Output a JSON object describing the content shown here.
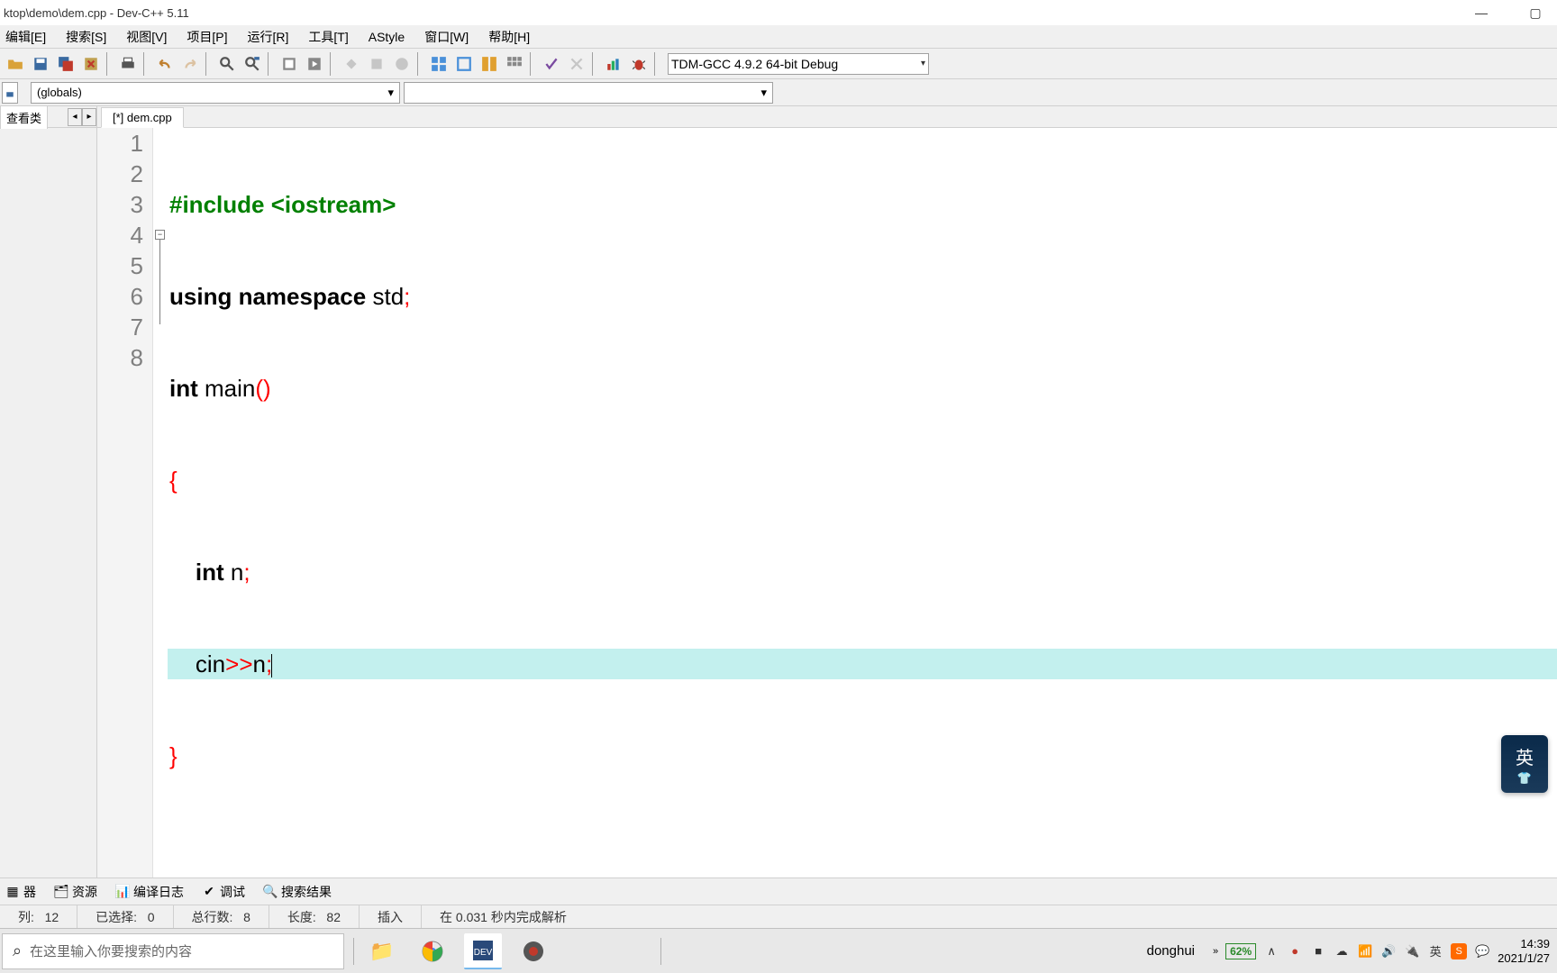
{
  "title": "ktop\\demo\\dem.cpp - Dev-C++ 5.11",
  "menu": [
    "编辑[E]",
    "搜索[S]",
    "视图[V]",
    "项目[P]",
    "运行[R]",
    "工具[T]",
    "AStyle",
    "窗口[W]",
    "帮助[H]"
  ],
  "compiler": "TDM-GCC 4.9.2 64-bit Debug",
  "scope_global": "(globals)",
  "side_tab": "查看类",
  "editor_tab": "[*] dem.cpp",
  "code": {
    "lines": [
      "1",
      "2",
      "3",
      "4",
      "5",
      "6",
      "7",
      "8"
    ],
    "l1_pp": "#include <iostream>",
    "l2_kw1": "using",
    "l2_kw2": "namespace",
    "l2_id": "std",
    "l3_kw": "int",
    "l3_id": "main",
    "l5_kw": "int",
    "l5_id": "n",
    "l6_id1": "cin",
    "l6_id2": "n"
  },
  "bottom_tabs": [
    "器",
    "资源",
    "编译日志",
    "调试",
    "搜索结果"
  ],
  "status": {
    "col_lbl": "列:",
    "col_val": "12",
    "sel_lbl": "已选择:",
    "sel_val": "0",
    "lines_lbl": "总行数:",
    "lines_val": "8",
    "len_lbl": "长度:",
    "len_val": "82",
    "ins": "插入",
    "parse": "在 0.031 秒内完成解析"
  },
  "ime": {
    "lang": "英"
  },
  "taskbar": {
    "search_placeholder": "在这里输入你要搜索的内容",
    "username": "donghui",
    "battery": "62%",
    "time": "14:39",
    "date": "2021/1/27"
  }
}
